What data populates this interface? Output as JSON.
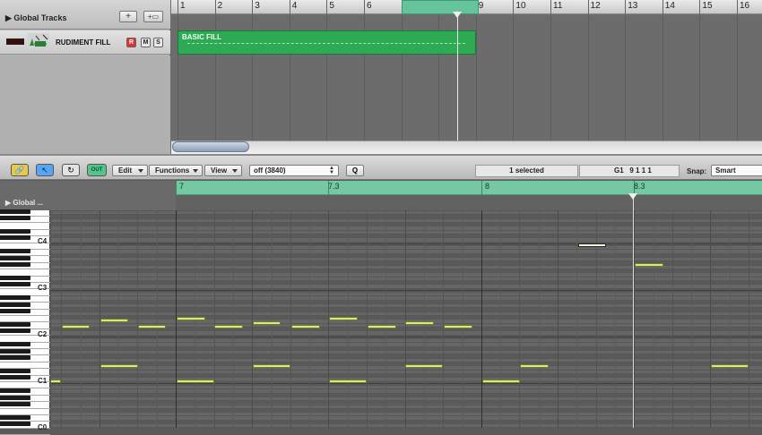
{
  "arrange": {
    "global_tracks_label": "Global Tracks",
    "add_track_label": "+",
    "add_folder_label": "+▭",
    "ruler_bars": [
      "1",
      "2",
      "3",
      "4",
      "5",
      "6",
      "7",
      "8",
      "9",
      "10",
      "11",
      "12",
      "13",
      "14",
      "15",
      "16"
    ],
    "track": {
      "name": "RUDIMENT FILL",
      "record": "R",
      "mute": "M",
      "solo": "S"
    },
    "region_name": "BASIC FILL"
  },
  "piano_roll": {
    "toolbar": {
      "out_label": "OUT",
      "edit_menu": "Edit",
      "functions_menu": "Functions",
      "view_menu": "View",
      "quantize_value": "off (3840)",
      "quantize_button": "Q",
      "selected_text": "1 selected",
      "position_pitch": "G1",
      "position_time": "9 1 1 1",
      "snap_label": "Snap:",
      "snap_value": "Smart"
    },
    "global_label": "Global ...",
    "ruler_labels": [
      "7",
      "7.3",
      "8",
      "8.3"
    ],
    "octave_labels": [
      "C4",
      "C3",
      "C2",
      "C1",
      "C0"
    ]
  },
  "colors": {
    "region_green": "#2eaa55",
    "cycle_green": "#66c49c",
    "note_yellow": "#d8e77f",
    "record_red": "#dd3333"
  }
}
